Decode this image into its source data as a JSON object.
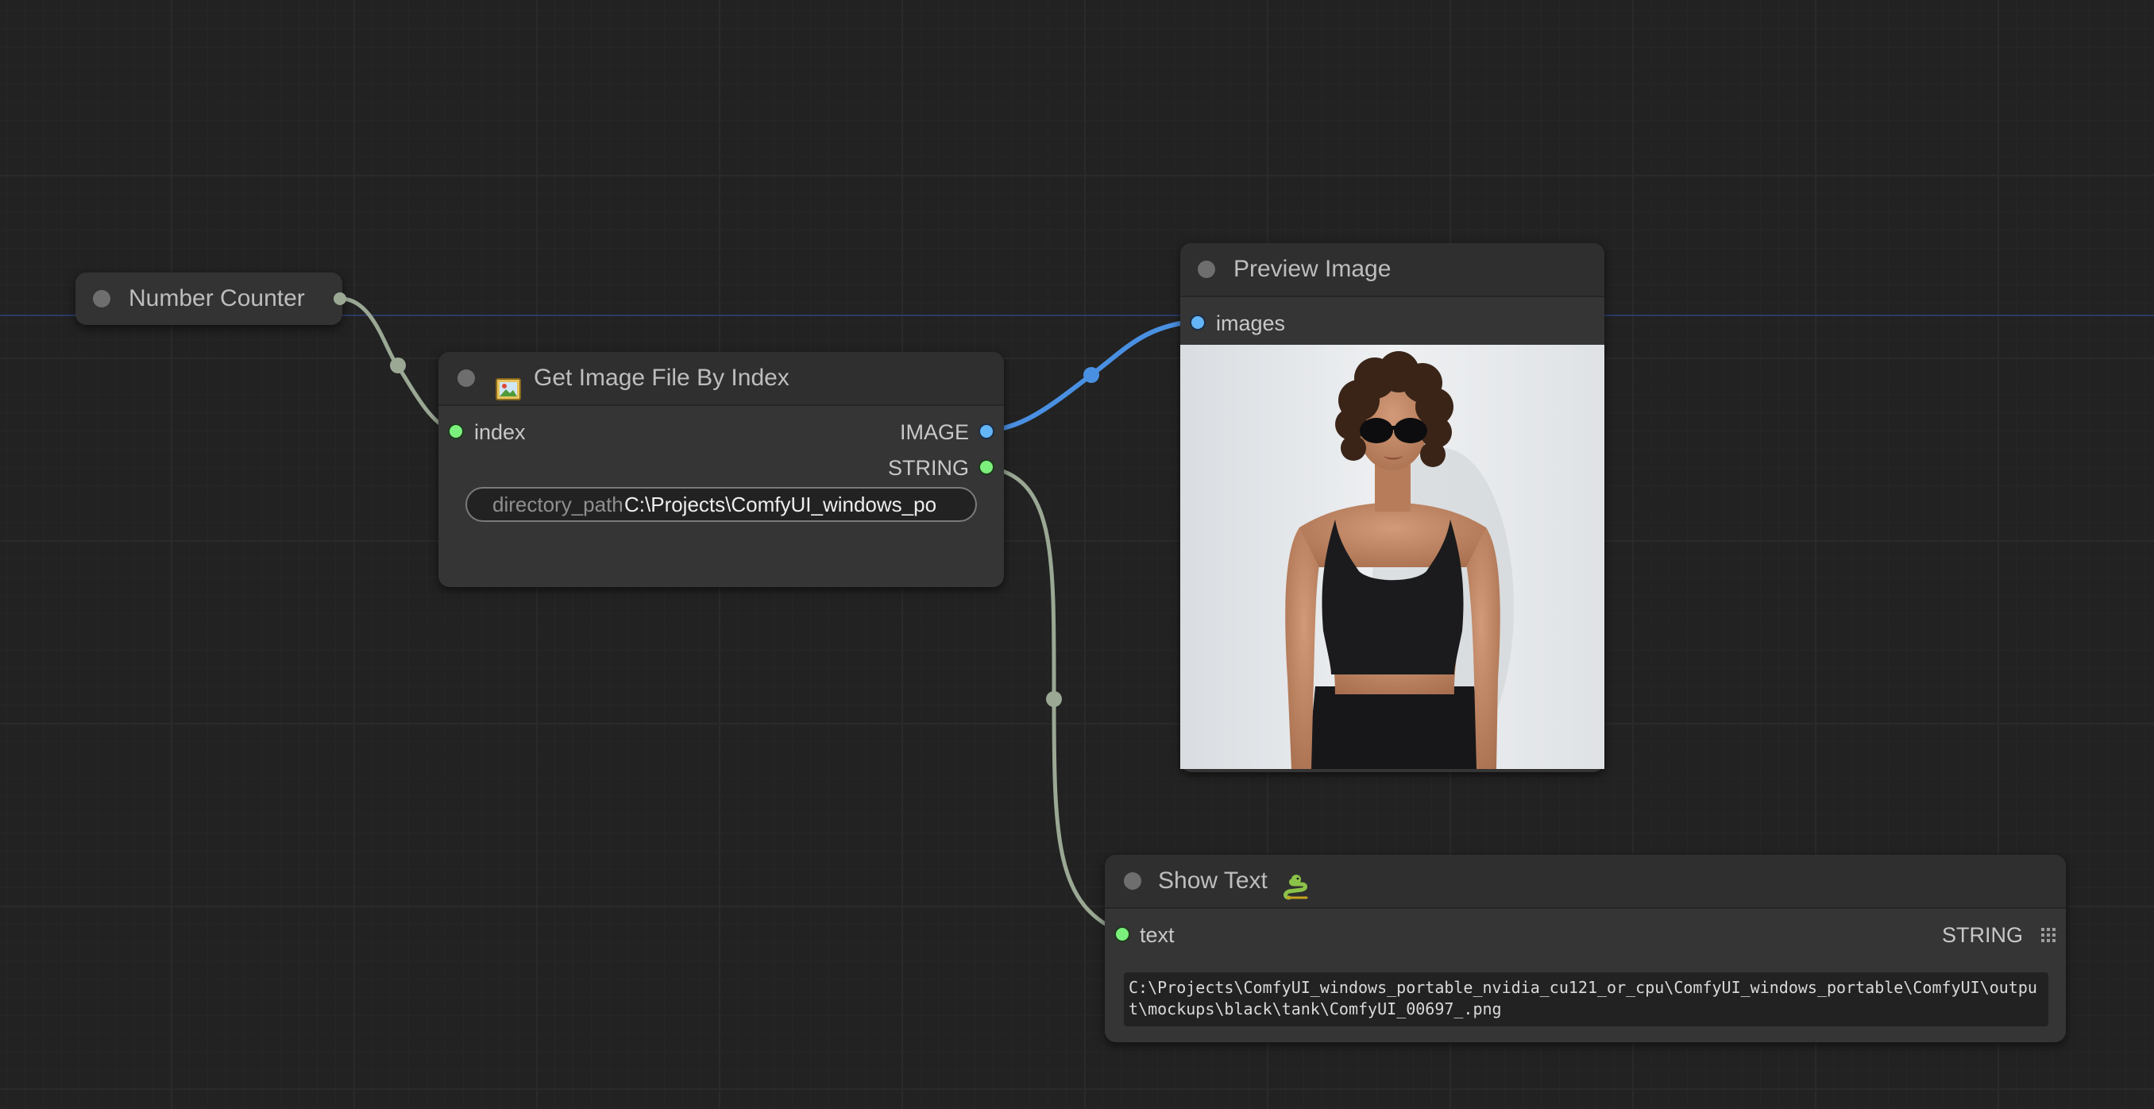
{
  "nodes": {
    "number_counter": {
      "title": "Number Counter"
    },
    "get_image_file": {
      "icon": "image-file-icon",
      "title": "Get Image File By Index",
      "inputs": [
        {
          "label": "index",
          "type_color": "#7cf07c"
        }
      ],
      "outputs": [
        {
          "label": "IMAGE",
          "type_color": "#64b5f6"
        },
        {
          "label": "STRING",
          "type_color": "#7cf07c"
        }
      ],
      "widget": {
        "name": "directory_path",
        "value": "C:\\Projects\\ComfyUI_windows_po"
      }
    },
    "preview_image": {
      "title": "Preview Image",
      "inputs": [
        {
          "label": "images",
          "type_color": "#64b5f6"
        }
      ],
      "image": {
        "description_icon": "preview-photo-woman-sunglasses-black-tank-top",
        "background_color": "#e4e7ea",
        "clothing_color": "#1b1b1d",
        "skin_color": "#c08866",
        "hair_color": "#3a2418"
      }
    },
    "show_text": {
      "title": "Show Text",
      "title_icon": "snake-icon",
      "inputs": [
        {
          "label": "text",
          "type_color": "#7cf07c"
        }
      ],
      "outputs": [
        {
          "label": "STRING",
          "type_color": "#7cf07c"
        }
      ],
      "grid_icon": "grid-icon",
      "text_value": "C:\\Projects\\ComfyUI_windows_portable_nvidia_cu121_or_cpu\\ComfyUI_windows_portable\\ComfyUI\\output\\mockups\\black\\tank\\ComfyUI_00697_.png"
    }
  },
  "links": [
    {
      "name": "link-counter-to-index",
      "color": "#9aa894"
    },
    {
      "name": "link-image-to-preview",
      "color": "#4a90e2"
    },
    {
      "name": "link-string-to-showtext",
      "color": "#9aa894"
    }
  ],
  "colors": {
    "canvas_bg": "#222222",
    "node_bg": "#353535",
    "title_text": "#bdbdbd",
    "accent_blue": "#4a90e2",
    "accent_green": "#7cf07c"
  }
}
